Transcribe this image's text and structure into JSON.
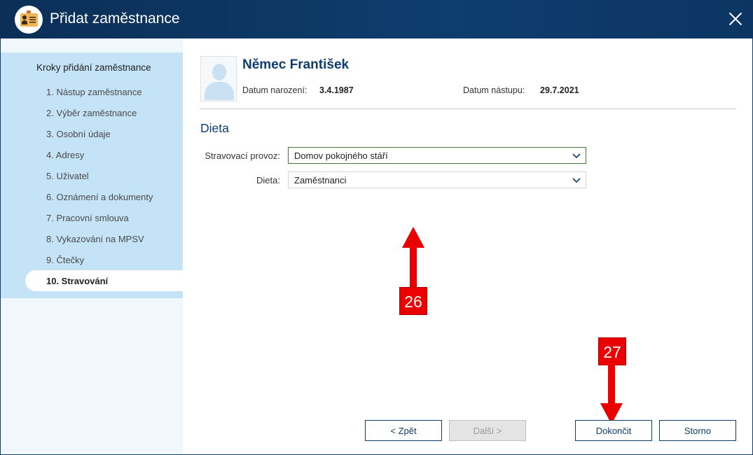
{
  "window": {
    "title": "Přidat zaměstnance",
    "icon": "employee-card-icon",
    "colors": {
      "titlebar": "#0e3d6e",
      "sidebar": "#c5e3f7",
      "accent": "#0e3d6e",
      "badge": "#ea0000"
    }
  },
  "sidebar": {
    "title": "Kroky přidání zaměstnance",
    "steps": [
      "1. Nástup zaměstnance",
      "2. Výběr zaměstnance",
      "3. Osobní údaje",
      "4. Adresy",
      "5. Uživatel",
      "6. Oznámení a dokumenty",
      "7. Pracovní smlouva",
      "8. Vykazování na MPSV",
      "9. Čtečky",
      "10. Stravování"
    ],
    "active_step": "10. Stravování"
  },
  "employee": {
    "name": "Němec František",
    "birth_label": "Datum narození:",
    "birth_value": "3.4.1987",
    "start_label": "Datum nástupu:",
    "start_value": "29.7.2021"
  },
  "form": {
    "section_title": "Dieta",
    "fields": {
      "provoz_label": "Stravovací provoz:",
      "provoz_value": "Domov pokojného stáří",
      "dieta_label": "Dieta:",
      "dieta_value": "Zaměstnanci"
    }
  },
  "buttons": {
    "back": "< Zpět",
    "next": "Další >",
    "finish": "Dokončit",
    "cancel": "Storno"
  },
  "annotations": {
    "badge_26": "26",
    "badge_27": "27"
  }
}
